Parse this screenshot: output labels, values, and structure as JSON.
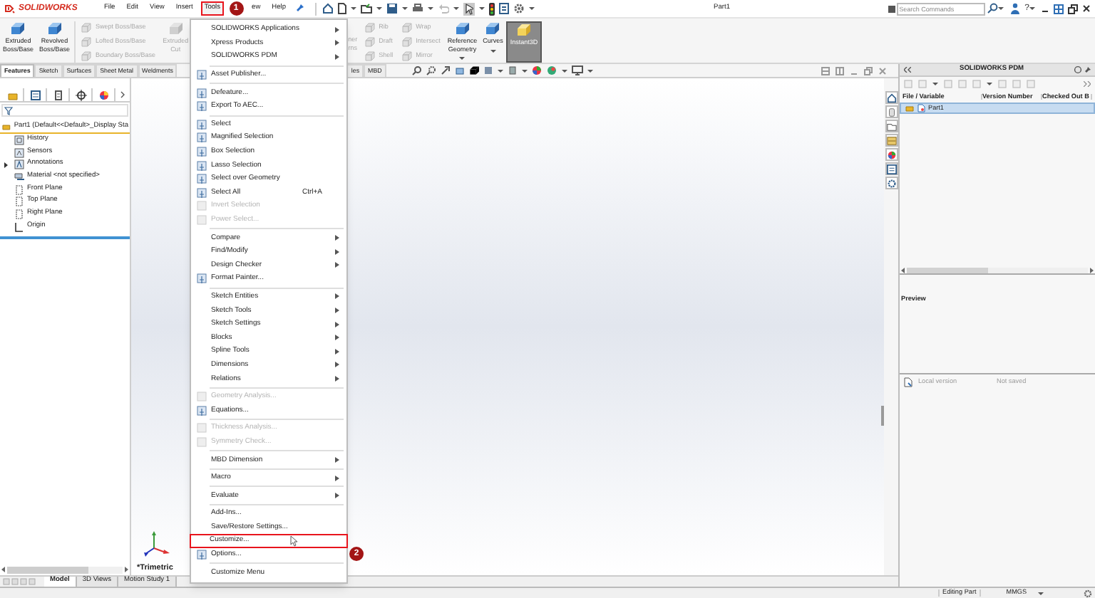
{
  "title_bar": {
    "logo": "SOLIDWORKS",
    "menus": [
      {
        "label": "File",
        "selected": false
      },
      {
        "label": "Edit",
        "selected": false
      },
      {
        "label": "View",
        "selected": false
      },
      {
        "label": "Insert",
        "selected": false
      },
      {
        "label": "Tools",
        "selected": true
      },
      {
        "label": "ew",
        "selected": false
      },
      {
        "label": "Help",
        "selected": false
      }
    ],
    "document_title": "Part1",
    "search": {
      "placeholder": "Search Commands"
    },
    "help_label": "?"
  },
  "ribbon": {
    "groups": [
      {
        "kind": "large",
        "label": "Extruded\nBoss/Base",
        "disabled": false,
        "selected": false
      },
      {
        "kind": "large",
        "label": "Revolved\nBoss/Base",
        "disabled": false,
        "selected": false
      },
      {
        "kind": "stack",
        "items": [
          {
            "label": "Swept Boss/Base",
            "disabled": true
          },
          {
            "label": "Lofted Boss/Base",
            "disabled": true
          },
          {
            "label": "Boundary Boss/Base",
            "disabled": true
          }
        ]
      },
      {
        "kind": "large",
        "label": "Extruded\nCut",
        "disabled": true,
        "selected": false
      },
      {
        "kind": "partial",
        "label": "ner\nrns",
        "disabled": true,
        "selected": false
      },
      {
        "kind": "stack",
        "items": [
          {
            "label": "Rib",
            "disabled": true
          },
          {
            "label": "Draft",
            "disabled": true
          },
          {
            "label": "Shell",
            "disabled": true
          }
        ]
      },
      {
        "kind": "stack",
        "items": [
          {
            "label": "Wrap",
            "disabled": true
          },
          {
            "label": "Intersect",
            "disabled": true
          },
          {
            "label": "Mirror",
            "disabled": true
          }
        ]
      },
      {
        "kind": "large",
        "label": "Reference\nGeometry",
        "disabled": false,
        "selected": false
      },
      {
        "kind": "large",
        "label": "Curves",
        "disabled": false,
        "selected": false
      },
      {
        "kind": "large",
        "label": "Instant3D",
        "disabled": false,
        "selected": true
      }
    ]
  },
  "command_tabs": [
    {
      "label": "Features",
      "selected": true,
      "partial": false
    },
    {
      "label": "Sketch",
      "selected": false,
      "partial": false
    },
    {
      "label": "Surfaces",
      "selected": false,
      "partial": false
    },
    {
      "label": "Sheet Metal",
      "selected": false,
      "partial": false
    },
    {
      "label": "Weldments",
      "selected": false,
      "partial": false
    },
    {
      "label": "les",
      "selected": false,
      "partial": true
    },
    {
      "label": "MBD",
      "selected": false,
      "partial": false
    }
  ],
  "feature_tree": {
    "root": {
      "label": "Part1  (Default<<Default>_Display Sta",
      "children": [
        {
          "label": "History",
          "expandable": false
        },
        {
          "label": "Sensors",
          "expandable": false
        },
        {
          "label": "Annotations",
          "expandable": true
        },
        {
          "label": "Material <not specified>",
          "expandable": false
        },
        {
          "label": "Front Plane",
          "expandable": false
        },
        {
          "label": "Top Plane",
          "expandable": false
        },
        {
          "label": "Right Plane",
          "expandable": false
        },
        {
          "label": "Origin",
          "expandable": false
        }
      ]
    }
  },
  "graphics": {
    "view_label": "*Trimetric"
  },
  "bottom_tabs": [
    {
      "label": "Model",
      "selected": true
    },
    {
      "label": "3D Views",
      "selected": false
    },
    {
      "label": "Motion Study 1",
      "selected": false
    }
  ],
  "status_bar": {
    "mode": "Editing Part",
    "units": "MMGS"
  },
  "pdm_panel": {
    "title": "SOLIDWORKS PDM",
    "columns": [
      "File / Variable",
      "Version Number",
      "Checked Out B"
    ],
    "rows": [
      {
        "name": "Part1",
        "selected": true
      }
    ],
    "preview_label": "Preview",
    "local_version": {
      "label": "Local version",
      "value": "Not saved"
    }
  },
  "tools_menu": {
    "groups": [
      [
        {
          "label": "SOLIDWORKS Applications",
          "submenu": true,
          "disabled": false,
          "has_icon": false,
          "highlighted": false
        },
        {
          "label": "Xpress Products",
          "submenu": true,
          "disabled": false,
          "has_icon": false,
          "highlighted": false
        },
        {
          "label": "SOLIDWORKS PDM",
          "submenu": true,
          "disabled": false,
          "has_icon": false,
          "highlighted": false
        }
      ],
      [
        {
          "label": "Asset Publisher...",
          "submenu": false,
          "disabled": false,
          "has_icon": true,
          "highlighted": false
        }
      ],
      [
        {
          "label": "Defeature...",
          "submenu": false,
          "disabled": false,
          "has_icon": true,
          "highlighted": false
        },
        {
          "label": "Export To AEC...",
          "submenu": false,
          "disabled": false,
          "has_icon": true,
          "highlighted": false
        }
      ],
      [
        {
          "label": "Select",
          "submenu": false,
          "disabled": false,
          "has_icon": true,
          "highlighted": false
        },
        {
          "label": "Magnified Selection",
          "submenu": false,
          "disabled": false,
          "has_icon": true,
          "highlighted": false
        },
        {
          "label": "Box Selection",
          "submenu": false,
          "disabled": false,
          "has_icon": true,
          "highlighted": false
        },
        {
          "label": "Lasso Selection",
          "submenu": false,
          "disabled": false,
          "has_icon": true,
          "highlighted": false
        },
        {
          "label": "Select over Geometry",
          "submenu": false,
          "disabled": false,
          "has_icon": true,
          "highlighted": false
        },
        {
          "label": "Select All",
          "shortcut": "Ctrl+A",
          "submenu": false,
          "disabled": false,
          "has_icon": true,
          "highlighted": false
        },
        {
          "label": "Invert Selection",
          "submenu": false,
          "disabled": true,
          "has_icon": true,
          "highlighted": false
        },
        {
          "label": "Power Select...",
          "submenu": false,
          "disabled": true,
          "has_icon": true,
          "highlighted": false
        }
      ],
      [
        {
          "label": "Compare",
          "submenu": true,
          "disabled": false,
          "has_icon": false,
          "highlighted": false
        },
        {
          "label": "Find/Modify",
          "submenu": true,
          "disabled": false,
          "has_icon": false,
          "highlighted": false
        },
        {
          "label": "Design Checker",
          "submenu": true,
          "disabled": false,
          "has_icon": false,
          "highlighted": false
        },
        {
          "label": "Format Painter...",
          "submenu": false,
          "disabled": false,
          "has_icon": true,
          "highlighted": false
        }
      ],
      [
        {
          "label": "Sketch Entities",
          "submenu": true,
          "disabled": false,
          "has_icon": false,
          "highlighted": false
        },
        {
          "label": "Sketch Tools",
          "submenu": true,
          "disabled": false,
          "has_icon": false,
          "highlighted": false
        },
        {
          "label": "Sketch Settings",
          "submenu": true,
          "disabled": false,
          "has_icon": false,
          "highlighted": false
        },
        {
          "label": "Blocks",
          "submenu": true,
          "disabled": false,
          "has_icon": false,
          "highlighted": false
        },
        {
          "label": "Spline Tools",
          "submenu": true,
          "disabled": false,
          "has_icon": false,
          "highlighted": false
        },
        {
          "label": "Dimensions",
          "submenu": true,
          "disabled": false,
          "has_icon": false,
          "highlighted": false
        },
        {
          "label": "Relations",
          "submenu": true,
          "disabled": false,
          "has_icon": false,
          "highlighted": false
        }
      ],
      [
        {
          "label": "Geometry Analysis...",
          "submenu": false,
          "disabled": true,
          "has_icon": true,
          "highlighted": false
        },
        {
          "label": "Equations...",
          "submenu": false,
          "disabled": false,
          "has_icon": true,
          "highlighted": false
        }
      ],
      [
        {
          "label": "Thickness Analysis...",
          "submenu": false,
          "disabled": true,
          "has_icon": true,
          "highlighted": false
        },
        {
          "label": "Symmetry Check...",
          "submenu": false,
          "disabled": true,
          "has_icon": true,
          "highlighted": false
        }
      ],
      [
        {
          "label": "MBD Dimension",
          "submenu": true,
          "disabled": false,
          "has_icon": false,
          "highlighted": false
        }
      ],
      [
        {
          "label": "Macro",
          "submenu": true,
          "disabled": false,
          "has_icon": false,
          "highlighted": false
        }
      ],
      [
        {
          "label": "Evaluate",
          "submenu": true,
          "disabled": false,
          "has_icon": false,
          "highlighted": false
        }
      ],
      [
        {
          "label": "Add-Ins...",
          "submenu": false,
          "disabled": false,
          "has_icon": false,
          "highlighted": false
        },
        {
          "label": "Save/Restore Settings...",
          "submenu": false,
          "disabled": false,
          "has_icon": false,
          "highlighted": false
        },
        {
          "label": "Customize...",
          "submenu": false,
          "disabled": false,
          "has_icon": false,
          "highlighted": true
        },
        {
          "label": "Options...",
          "submenu": false,
          "disabled": false,
          "has_icon": true,
          "highlighted": false
        }
      ],
      [
        {
          "label": "Customize Menu",
          "submenu": false,
          "disabled": false,
          "has_icon": false,
          "highlighted": false
        }
      ]
    ]
  },
  "callouts": [
    {
      "label": "1"
    },
    {
      "label": "2"
    }
  ]
}
